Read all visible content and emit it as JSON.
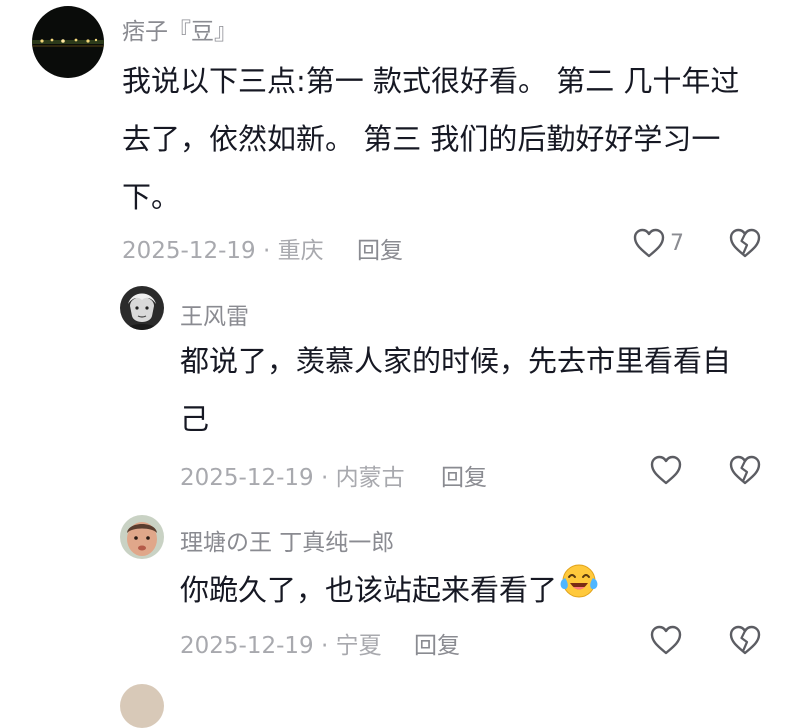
{
  "comments": [
    {
      "username": "痞子『豆』",
      "text_lines": [
        "我说以下三点:第一 款式很好看。 第二 几十年过",
        "去了，依然如新。 第三 我们的后勤好好学习一",
        "下。"
      ],
      "date_location": "2025-12-19 · 重庆",
      "reply_label": "回复",
      "like_count": "7"
    },
    {
      "username": "王风雷",
      "text_lines": [
        "都说了，羡慕人家的时候，先去市里看看自",
        "己"
      ],
      "date_location": "2025-12-19 · 内蒙古",
      "reply_label": "回复"
    },
    {
      "username": "理塘の王 丁真纯一郎",
      "text_lines": [
        "你跪久了，也该站起来看看了"
      ],
      "date_location": "2025-12-19 · 宁夏",
      "reply_label": "回复"
    }
  ],
  "icons": [
    "heart-outline-icon",
    "broken-heart-icon",
    "laughing-crying-emoji"
  ],
  "colors": {
    "text": "#161823",
    "username": "#8a8b91",
    "meta": "#a8a9ae",
    "icon": "#5c5d63"
  }
}
